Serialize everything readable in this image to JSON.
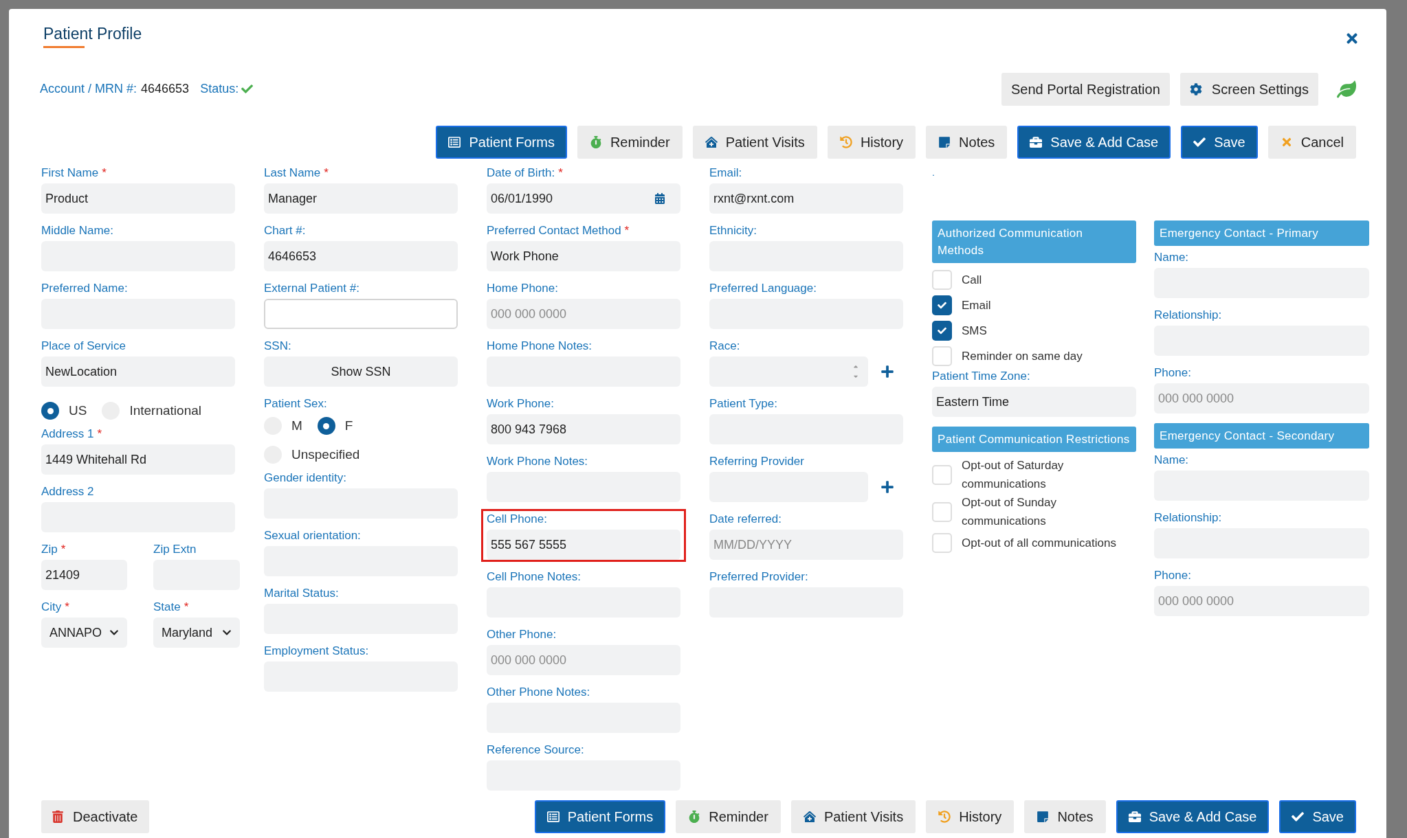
{
  "title": "Patient Profile",
  "account": {
    "label": "Account / MRN #:",
    "value": "4646653",
    "status_label": "Status:",
    "status_ok": true
  },
  "header_buttons": [
    {
      "label": "Send Portal Registration"
    },
    {
      "label": "Screen Settings"
    }
  ],
  "toolbar": [
    {
      "label": "Patient Forms",
      "kind": "primary"
    },
    {
      "label": "Reminder",
      "kind": "secondary"
    },
    {
      "label": "Patient Visits",
      "kind": "secondary"
    },
    {
      "label": "History",
      "kind": "secondary"
    },
    {
      "label": "Notes",
      "kind": "secondary"
    },
    {
      "label": "Save & Add Case",
      "kind": "primary"
    },
    {
      "label": "Save",
      "kind": "primary"
    },
    {
      "label": "Cancel",
      "kind": "secondary"
    }
  ],
  "columns": [
    {
      "items": [
        {
          "kind": "field",
          "label": "First Name",
          "required_mark": "*",
          "value": "Product"
        },
        {
          "kind": "field",
          "label": "Middle Name:"
        },
        {
          "kind": "field",
          "label": "Preferred Name:"
        },
        {
          "kind": "field",
          "label": "Place of Service",
          "value": "NewLocation"
        },
        {
          "kind": "radios",
          "options": [
            {
              "label": "US",
              "selected": true
            },
            {
              "label": "International",
              "selected": false
            }
          ]
        },
        {
          "kind": "field",
          "label": "Address 1",
          "required_mark": "*",
          "value": "1449 Whitehall Rd"
        },
        {
          "kind": "field",
          "label": "Address 2"
        },
        {
          "kind": "pair",
          "items": [
            {
              "kind": "field",
              "label": "Zip",
              "required_mark": "*",
              "value": "21409"
            },
            {
              "kind": "field",
              "label": "Zip Extn"
            }
          ]
        },
        {
          "kind": "pair",
          "items": [
            {
              "kind": "select",
              "label": "City",
              "required_mark": "*",
              "value": "ANNAPO"
            },
            {
              "kind": "select",
              "label": "State",
              "required_mark": "*",
              "value": "Maryland"
            }
          ]
        }
      ]
    },
    {
      "items": [
        {
          "kind": "field",
          "label": "Last Name",
          "required_mark": "*",
          "value": "Manager"
        },
        {
          "kind": "field",
          "label": "Chart #:",
          "value": "4646653"
        },
        {
          "kind": "outlined",
          "label": "External Patient #:"
        },
        {
          "kind": "button",
          "label": "SSN:",
          "value": "Show SSN"
        },
        {
          "kind": "radios",
          "label": "Patient Sex:",
          "options": [
            {
              "label": "M",
              "selected": false
            },
            {
              "label": "F",
              "selected": true
            },
            {
              "label": "Unspecified",
              "selected": false
            }
          ]
        },
        {
          "kind": "field",
          "label": "Gender identity:"
        },
        {
          "kind": "field",
          "label": "Sexual orientation:"
        },
        {
          "kind": "field",
          "label": "Marital Status:"
        },
        {
          "kind": "field",
          "label": "Employment Status:"
        }
      ]
    },
    {
      "items": [
        {
          "kind": "date",
          "label": "Date of Birth:",
          "required_mark": "*",
          "value": "06/01/1990"
        },
        {
          "kind": "field",
          "label": "Preferred Contact Method",
          "required_mark": "*",
          "value": "Work Phone"
        },
        {
          "kind": "field",
          "label": "Home Phone:",
          "placeholder": "000 000 0000"
        },
        {
          "kind": "field",
          "label": "Home Phone Notes:"
        },
        {
          "kind": "field",
          "label": "Work Phone:",
          "value": "800 943 7968"
        },
        {
          "kind": "field",
          "label": "Work Phone Notes:"
        },
        {
          "kind": "field",
          "label": "Cell Phone:",
          "value": "555 567 5555",
          "highlighted": true
        },
        {
          "kind": "field",
          "label": "Cell Phone Notes:"
        },
        {
          "kind": "field",
          "label": "Other Phone:",
          "placeholder": "000 000 0000"
        },
        {
          "kind": "field",
          "label": "Other Phone Notes:"
        },
        {
          "kind": "field",
          "label": "Reference Source:"
        }
      ]
    },
    {
      "items": [
        {
          "kind": "field",
          "label": "Email:",
          "value": "rxnt@rxnt.com"
        },
        {
          "kind": "field",
          "label": "Ethnicity:"
        },
        {
          "kind": "field",
          "label": "Preferred Language:"
        },
        {
          "kind": "spinner",
          "label": "Race:"
        },
        {
          "kind": "field",
          "label": "Patient Type:"
        },
        {
          "kind": "add",
          "label": "Referring Provider"
        },
        {
          "kind": "field",
          "label": "Date referred:",
          "placeholder": "MM/DD/YYYY"
        },
        {
          "kind": "field",
          "label": "Preferred Provider:"
        }
      ]
    },
    {
      "items": [
        {
          "kind": "note",
          "label": "."
        },
        {
          "kind": "section",
          "label": "Authorized Communication Methods"
        },
        {
          "kind": "checkbox",
          "label": "Call",
          "checked": false
        },
        {
          "kind": "checkbox",
          "label": "Email",
          "checked": true
        },
        {
          "kind": "checkbox",
          "label": "SMS",
          "checked": true
        },
        {
          "kind": "checkbox",
          "label": "Reminder on same day",
          "checked": false
        },
        {
          "kind": "field",
          "label": "Patient Time Zone:",
          "value": "Eastern Time"
        },
        {
          "kind": "section",
          "label": "Patient Communication Restrictions"
        },
        {
          "kind": "checkbox",
          "label": "Opt-out of Saturday communications",
          "checked": false
        },
        {
          "kind": "checkbox",
          "label": "Opt-out of Sunday communications",
          "checked": false
        },
        {
          "kind": "checkbox",
          "label": "Opt-out of all communications",
          "checked": false
        }
      ]
    },
    {
      "items": [
        {
          "kind": "spacer"
        },
        {
          "kind": "section",
          "label": "Emergency Contact - Primary"
        },
        {
          "kind": "field",
          "label": "Name:"
        },
        {
          "kind": "field",
          "label": "Relationship:"
        },
        {
          "kind": "field",
          "label": "Phone:",
          "placeholder": "000 000 0000"
        },
        {
          "kind": "section",
          "label": "Emergency Contact - Secondary"
        },
        {
          "kind": "field",
          "label": "Name:"
        },
        {
          "kind": "field",
          "label": "Relationship:"
        },
        {
          "kind": "field",
          "label": "Phone:",
          "placeholder": "000 000 0000"
        }
      ]
    }
  ],
  "footer": {
    "deactivate": {
      "label": "Deactivate"
    },
    "buttons": [
      {
        "label": "Patient Forms",
        "kind": "primary"
      },
      {
        "label": "Reminder",
        "kind": "secondary"
      },
      {
        "label": "Patient Visits",
        "kind": "secondary"
      },
      {
        "label": "History",
        "kind": "secondary"
      },
      {
        "label": "Notes",
        "kind": "secondary"
      },
      {
        "label": "Save & Add Case",
        "kind": "primary"
      },
      {
        "label": "Save",
        "kind": "primary"
      }
    ]
  }
}
